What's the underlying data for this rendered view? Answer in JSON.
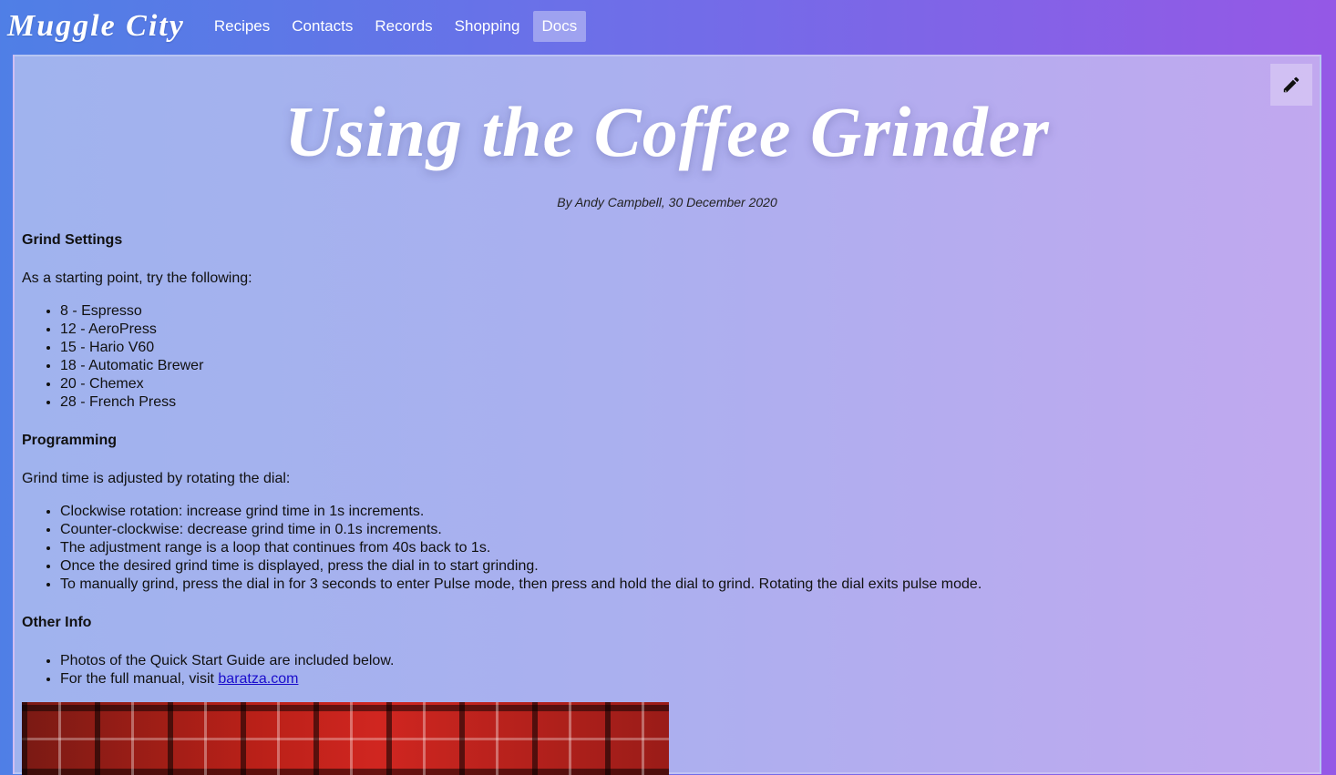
{
  "app": {
    "brand": "Muggle City"
  },
  "nav": {
    "items": [
      {
        "label": "Recipes",
        "active": false
      },
      {
        "label": "Contacts",
        "active": false
      },
      {
        "label": "Records",
        "active": false
      },
      {
        "label": "Shopping",
        "active": false
      },
      {
        "label": "Docs",
        "active": true
      }
    ]
  },
  "article": {
    "title": "Using the Coffee Grinder",
    "byline": "By Andy Campbell, 30 December 2020",
    "edit_icon": "pencil-icon",
    "sections": {
      "grind": {
        "heading": "Grind Settings",
        "intro": "As a starting point, try the following:",
        "items": [
          "8 - Espresso",
          "12 - AeroPress",
          "15 - Hario V60",
          "18 - Automatic Brewer",
          "20 - Chemex",
          "28 - French Press"
        ]
      },
      "programming": {
        "heading": "Programming",
        "intro": "Grind time is adjusted by rotating the dial:",
        "items": [
          "Clockwise rotation: increase grind time in 1s increments.",
          "Counter-clockwise: decrease grind time in 0.1s increments.",
          "The adjustment range is a loop that continues from 40s back to 1s.",
          "Once the desired grind time is displayed, press the dial in to start grinding.",
          "To manually grind, press the dial in for 3 seconds to enter Pulse mode, then press and hold the dial to grind. Rotating the dial exits pulse mode."
        ]
      },
      "other": {
        "heading": "Other Info",
        "item_1": "Photos of the Quick Start Guide are included below.",
        "item_2_prefix": "For the full manual, visit ",
        "item_2_link": "baratza.com"
      }
    }
  },
  "colors": {
    "accent_gradient_start": "#4f7fe6",
    "accent_gradient_end": "#9558e6",
    "link": "#1a0dcc"
  }
}
